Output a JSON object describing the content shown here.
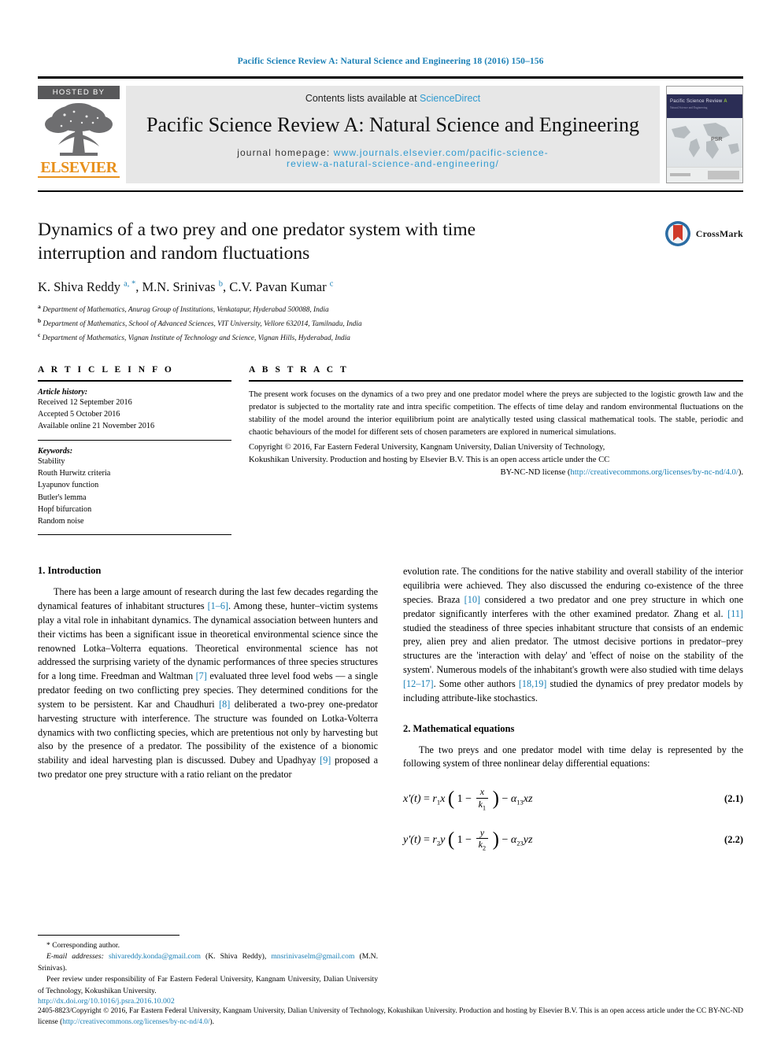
{
  "running_head": "Pacific Science Review A: Natural Science and Engineering 18 (2016) 150–156",
  "masthead": {
    "hosted_by": "HOSTED BY",
    "publisher": "ELSEVIER",
    "contents_prefix": "Contents lists available at ",
    "sciencedirect": "ScienceDirect",
    "journal_title": "Pacific Science Review A: Natural Science and Engineering",
    "homepage_label": "journal homepage: ",
    "homepage_url_line1": "www.journals.elsevier.com/pacific-science-",
    "homepage_url_line2": "review-a-natural-science-and-engineering/",
    "cover": {
      "title": "Pacific Science Review",
      "title_letter": "A",
      "subtitle": "Natural Science and Engineering",
      "map_label": "PSR"
    }
  },
  "article": {
    "title": "Dynamics of a two prey and one predator system with time interruption and random fluctuations",
    "crossmark_label": "CrossMark",
    "authors_html": "K. Shiva Reddy <sup>a, *</sup>, M.N. Srinivas <sup>b</sup>, C.V. Pavan Kumar <sup>c</sup>",
    "affiliations": [
      {
        "marker": "a",
        "text": "Department of Mathematics, Anurag Group of Institutions, Venkatapur, Hyderabad 500088, India"
      },
      {
        "marker": "b",
        "text": "Department of Mathematics, School of Advanced Sciences, VIT University, Vellore 632014, Tamilnadu, India"
      },
      {
        "marker": "c",
        "text": "Department of Mathematics, Vignan Institute of Technology and Science, Vignan Hills, Hyderabad, India"
      }
    ]
  },
  "article_info": {
    "heading": "A R T I C L E  I N F O",
    "history_label": "Article history:",
    "history": [
      "Received 12 September 2016",
      "Accepted 5 October 2016",
      "Available online 21 November 2016"
    ],
    "keywords_label": "Keywords:",
    "keywords": [
      "Stability",
      "Routh Hurwitz criteria",
      "Lyapunov function",
      "Butler's lemma",
      "Hopf bifurcation",
      "Random noise"
    ]
  },
  "abstract": {
    "heading": "A B S T R A C T",
    "text": "The present work focuses on the dynamics of a two prey and one predator model where the preys are subjected to the logistic growth law and the predator is subjected to the mortality rate and intra specific competition. The effects of time delay and random environmental fluctuations on the stability of the model around the interior equilibrium point are analytically tested using classical mathematical tools. The stable, periodic and chaotic behaviours of the model for different sets of chosen parameters are explored in numerical simulations.",
    "copyright_line1": "Copyright © 2016, Far Eastern Federal University, Kangnam University, Dalian University of Technology,",
    "copyright_line2": "Kokushikan University. Production and hosting by Elsevier B.V. This is an open access article under the CC",
    "copyright_line3_prefix": "BY-NC-ND license (",
    "copyright_link": "http://creativecommons.org/licenses/by-nc-nd/4.0/",
    "copyright_line3_suffix": ")."
  },
  "sections": {
    "intro_heading": "1. Introduction",
    "math_heading": "2. Mathematical equations",
    "intro_p1_a": "There has been a large amount of research during the last few decades regarding the dynamical features of inhabitant structures ",
    "intro_ref_1_6": "[1–6]",
    "intro_p1_b": ". Among these, hunter–victim systems play a vital role in inhabitant dynamics. The dynamical association between hunters and their victims has been a significant issue in theoretical environmental science since the renowned Lotka–Volterra equations. Theoretical environmental science has not addressed the surprising variety of the dynamic performances of three species structures for a long time. Freedman and Waltman ",
    "intro_ref_7": "[7]",
    "intro_p1_c": " evaluated three level food webs — a single predator feeding on two conflicting prey species. They determined conditions for the system to be persistent. Kar and Chaudhuri ",
    "intro_ref_8": "[8]",
    "intro_p1_d": " deliberated a two-prey one-predator harvesting structure with interference. The structure was founded on Lotka-Volterra dynamics with two conflicting species, which are pretentious not only by harvesting but also by the presence of a predator. The possibility of the existence of a bionomic stability and ideal harvesting plan is discussed. Dubey and Upadhyay ",
    "intro_ref_9": "[9]",
    "intro_p1_e": " proposed a two predator one prey structure with a ratio reliant on the predator",
    "intro_p2_a": "evolution rate. The conditions for the native stability and overall stability of the interior equilibria were achieved. They also discussed the enduring co-existence of the three species. Braza ",
    "intro_ref_10": "[10]",
    "intro_p2_b": " considered a two predator and one prey structure in which one predator significantly interferes with the other examined predator. Zhang et al. ",
    "intro_ref_11": "[11]",
    "intro_p2_c": " studied the steadiness of three species inhabitant structure that consists of an endemic prey, alien prey and alien predator. The utmost decisive portions in predator–prey structures are the 'interaction with delay' and 'effect of noise on the stability of the system'. Numerous models of the inhabitant's growth were also studied with time delays ",
    "intro_ref_12_17": "[12–17]",
    "intro_p2_d": ". Some other authors ",
    "intro_ref_18_19": "[18,19]",
    "intro_p2_e": " studied the dynamics of prey predator models by including attribute-like stochastics.",
    "math_para": "The two preys and one predator model with time delay is represented by the following system of three nonlinear delay differential equations:"
  },
  "equations": [
    {
      "number": "(2.1)",
      "lhs": "x′(t)",
      "rate": "r",
      "rate_sub": "1",
      "var": "x",
      "frac_num": "x",
      "frac_den": "k",
      "frac_den_sub": "1",
      "alpha_sub": "13",
      "term": "xz"
    },
    {
      "number": "(2.2)",
      "lhs": "y′(t)",
      "rate": "r",
      "rate_sub": "2",
      "var": "y",
      "frac_num": "y",
      "frac_den": "k",
      "frac_den_sub": "2",
      "alpha_sub": "23",
      "term": "yz"
    }
  ],
  "footnotes": {
    "corresponding": "* Corresponding author.",
    "email_label": "E-mail addresses:",
    "email1": "shivareddy.konda@gmail.com",
    "email1_who": " (K. Shiva Reddy), ",
    "email2": "mnsrinivaselm@gmail.com",
    "email2_who": " (M.N. Srinivas).",
    "peer_review": "Peer review under responsibility of Far Eastern Federal University, Kangnam University, Dalian University of Technology, Kokushikan University."
  },
  "page_footer": {
    "doi": "http://dx.doi.org/10.1016/j.psra.2016.10.002",
    "line_a": "2405-8823/Copyright © 2016, Far Eastern Federal University, Kangnam University, Dalian University of Technology, Kokushikan University. Production and hosting by Elsevier B.V. This is an open access article under the CC BY-NC-ND license (",
    "license_link": "http://creativecommons.org/licenses/by-nc-nd/4.0/",
    "line_b": ")."
  },
  "colors": {
    "link": "#1a7fb5",
    "sciencedirect": "#2e9ad0",
    "elsevier_orange": "#e8901b",
    "masthead_gray": "#e7e7e7"
  }
}
